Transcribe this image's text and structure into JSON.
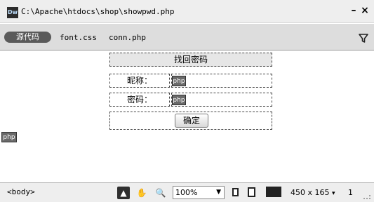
{
  "window": {
    "icon_text": "Dw",
    "title": "C:\\Apache\\htdocs\\shop\\showpwd.php",
    "min_glyph": "–",
    "close_glyph": "×"
  },
  "tabs": {
    "source_label": "源代码",
    "files": [
      "font.css",
      "conn.php"
    ]
  },
  "form": {
    "heading": "找回密码",
    "rows": [
      {
        "label": "昵称：",
        "php": "php"
      },
      {
        "label": "密码：",
        "php": "php"
      }
    ],
    "confirm_label": "确定",
    "stray_php": "php"
  },
  "status": {
    "tag_selector": "<body>",
    "zoom_value": "100%",
    "dimensions": "450 x 165",
    "dimensions_caret": "▾",
    "page": "1",
    "tools": {
      "pointer": "▲",
      "hand": "✋",
      "zoom": "🔍"
    }
  }
}
